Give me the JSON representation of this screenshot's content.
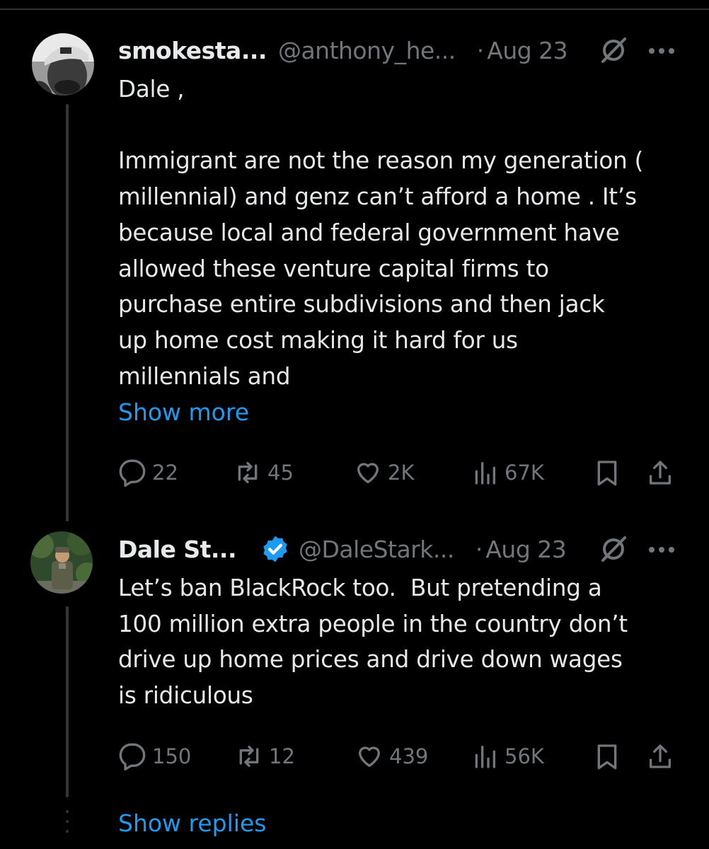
{
  "tweets": [
    {
      "display_name": "smokesta...",
      "handle": "@anthony_he...",
      "date": "Aug 23",
      "text": "Dale ,\n\nImmigrant are not the reason my generation (\nmillennial) and genz can’t afford a home . It’s\nbecause local and federal government have\nallowed these venture capital firms to\npurchase entire subdivisions and then jack\nup home cost making it hard for us\nmillennials and",
      "show_more": "Show more",
      "replies": "22",
      "reposts": "45",
      "likes": "2K",
      "views": "67K"
    },
    {
      "display_name": "Dale St...",
      "verified": true,
      "handle": "@DaleStark...",
      "date": "Aug 23",
      "text": "Let’s ban BlackRock too.  But pretending a\n100 million extra people in the country don’t\ndrive up home prices and drive down wages\nis ridiculous",
      "replies": "150",
      "reposts": "12",
      "likes": "439",
      "views": "56K"
    }
  ],
  "show_replies": "Show replies",
  "colors": {
    "background": "#000000",
    "text": "#e7e9ea",
    "muted": "#71767b",
    "link": "#1d9bf0",
    "verified": "#1d9bf0"
  },
  "icons": [
    "reply-icon",
    "repost-icon",
    "like-icon",
    "views-icon",
    "bookmark-icon",
    "share-icon",
    "grok-icon",
    "more-icon",
    "verified-badge-icon"
  ]
}
